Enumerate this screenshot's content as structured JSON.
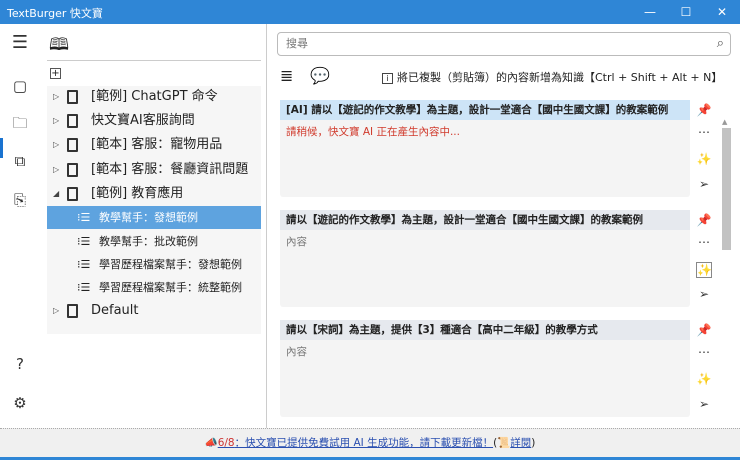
{
  "window": {
    "title": "TextBurger 快文寶",
    "minimize": "—",
    "maximize": "☐",
    "close": "✕"
  },
  "tree": {
    "items": [
      {
        "label": "[範例] ChatGPT 命令",
        "expanded": false
      },
      {
        "label": "快文寶AI客服詢問",
        "expanded": false
      },
      {
        "label": "[範本] 客服：寵物用品",
        "expanded": false
      },
      {
        "label": "[範本] 客服：餐廳資訊問題",
        "expanded": false
      },
      {
        "label": "[範例] 教育應用",
        "expanded": true
      },
      {
        "label": "Default",
        "expanded": false
      }
    ],
    "children": [
      "教學幫手：發想範例",
      "教學幫手：批改範例",
      "學習歷程檔案幫手：發想範例",
      "學習歷程檔案幫手：統整範例"
    ]
  },
  "search": {
    "placeholder": "搜尋"
  },
  "hint": "將已複製（剪貼簿）的內容新增為知識【Ctrl + Shift + Alt + N】",
  "cards": [
    {
      "title": "[AI] 請以【遊記的作文教學】為主題，設計一堂適合【國中生國文課】的教案範例",
      "content": "請稍候，快文寶 AI 正在產生內容中..."
    },
    {
      "title": "請以【遊記的作文教學】為主題，設計一堂適合【國中生國文課】的教案範例",
      "content": "內容"
    },
    {
      "title": "請以【宋詞】為主題，提供【3】種適合【高中二年級】的教學方式",
      "content": "內容"
    }
  ],
  "status": {
    "date": "6/8",
    "message": "：快文寶已提供免費試用 AI 生成功能，請下載更新檔！",
    "details": "詳閱"
  }
}
